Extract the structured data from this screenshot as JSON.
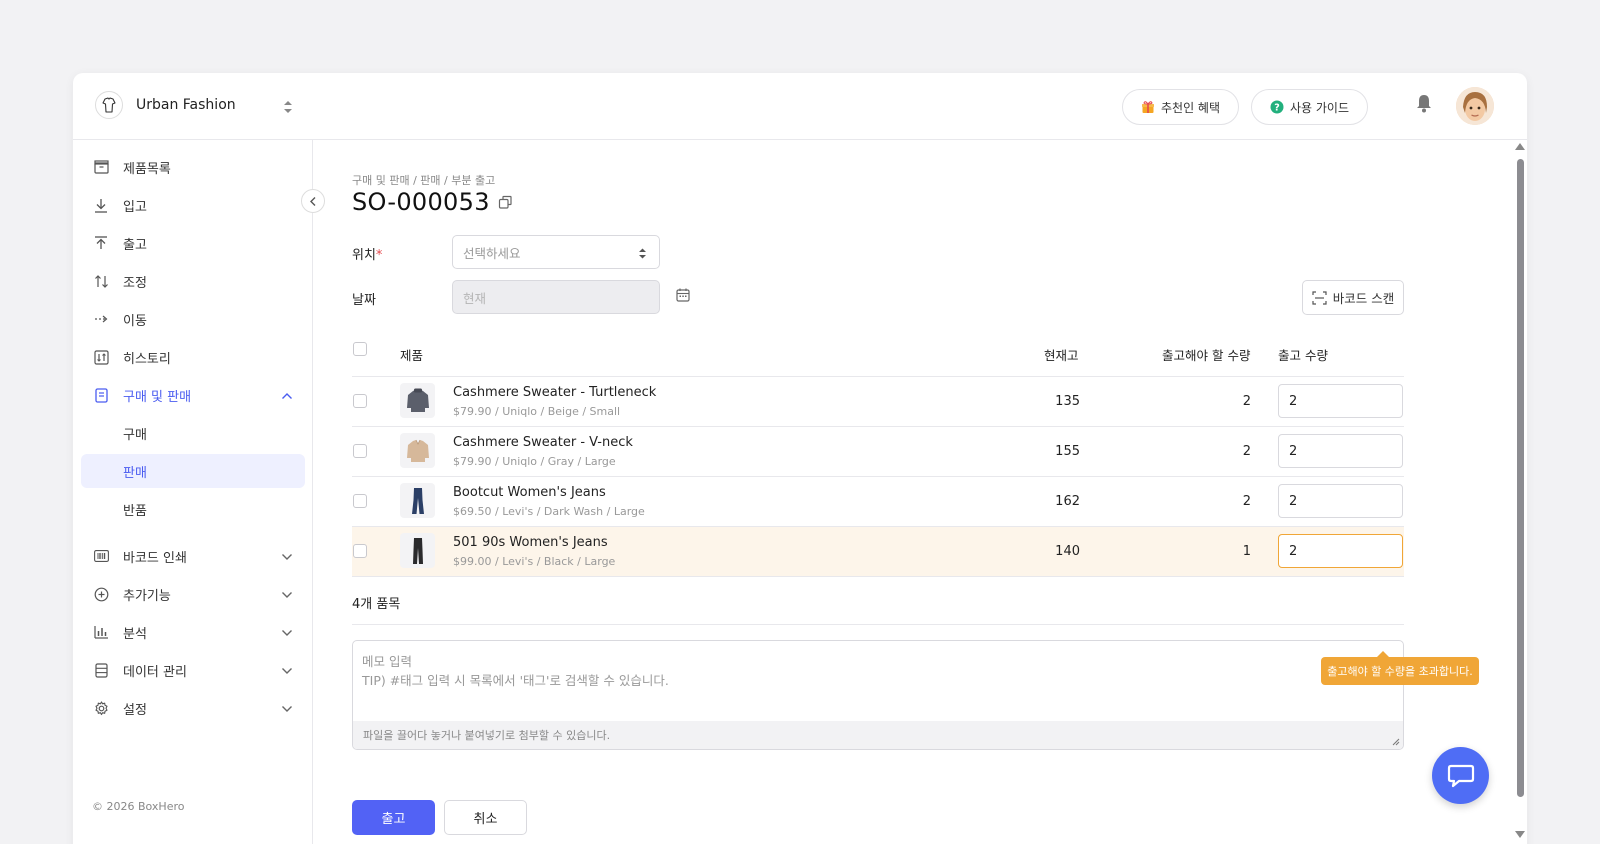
{
  "app": {
    "brand": "Urban Fashion",
    "copyright": "© 2026 BoxHero"
  },
  "header": {
    "referral_label": "추천인 혜택",
    "guide_label": "사용 가이드"
  },
  "sidebar": {
    "items": [
      {
        "label": "제품목록",
        "icon": "box-icon"
      },
      {
        "label": "입고",
        "icon": "arrow-down-icon"
      },
      {
        "label": "출고",
        "icon": "arrow-up-icon"
      },
      {
        "label": "조정",
        "icon": "swap-icon"
      },
      {
        "label": "이동",
        "icon": "arrow-right-dashed-icon"
      },
      {
        "label": "히스토리",
        "icon": "history-icon"
      },
      {
        "label": "구매 및 판매",
        "icon": "document-icon"
      }
    ],
    "sub_items": [
      {
        "label": "구매"
      },
      {
        "label": "판매"
      },
      {
        "label": "반품"
      }
    ],
    "more_items": [
      {
        "label": "바코드 인쇄",
        "icon": "barcode-icon"
      },
      {
        "label": "추가기능",
        "icon": "plus-circle-icon"
      },
      {
        "label": "분석",
        "icon": "bar-chart-icon"
      },
      {
        "label": "데이터 관리",
        "icon": "database-icon"
      },
      {
        "label": "설정",
        "icon": "gear-icon"
      }
    ]
  },
  "page": {
    "breadcrumb": "구매 및 판매 / 판매 / 부분 출고",
    "title": "SO-000053",
    "location_label": "위치",
    "location_required": "*",
    "location_placeholder": "선택하세요",
    "date_label": "날짜",
    "date_placeholder": "현재",
    "barcode_button": "바코드 스캔"
  },
  "table": {
    "columns": {
      "product": "제품",
      "stock": "현재고",
      "needed": "출고해야 할 수량",
      "qty": "출고 수량"
    },
    "rows": [
      {
        "name": "Cashmere Sweater - Turtleneck",
        "meta": "$79.90 / Uniqlo / Beige / Small",
        "stock": "135",
        "needed": "2",
        "qty": "2"
      },
      {
        "name": "Cashmere Sweater - V-neck",
        "meta": "$79.90 / Uniqlo / Gray / Large",
        "stock": "155",
        "needed": "2",
        "qty": "2"
      },
      {
        "name": "Bootcut Women's Jeans",
        "meta": "$69.50 / Levi's / Dark Wash / Large",
        "stock": "162",
        "needed": "2",
        "qty": "2"
      },
      {
        "name": "501 90s Women's Jeans",
        "meta": "$99.00 / Levi's / Black / Large",
        "stock": "140",
        "needed": "1",
        "qty": "2"
      }
    ],
    "warning_tooltip": "출고해야 할 수량을 초과합니다.",
    "item_count": "4개 품목"
  },
  "memo": {
    "placeholder_line1": "메모 입력",
    "placeholder_line2": "TIP) #태그 입력 시 목록에서 '태그'로 검색할 수 있습니다.",
    "attach_hint": "파일을 끌어다 놓거나 붙여넣기로 첨부할 수 있습니다."
  },
  "actions": {
    "submit": "출고",
    "cancel": "취소"
  },
  "colors": {
    "accent": "#5262f5",
    "warning": "#f0a637",
    "warning_row": "#fdf5ea"
  }
}
